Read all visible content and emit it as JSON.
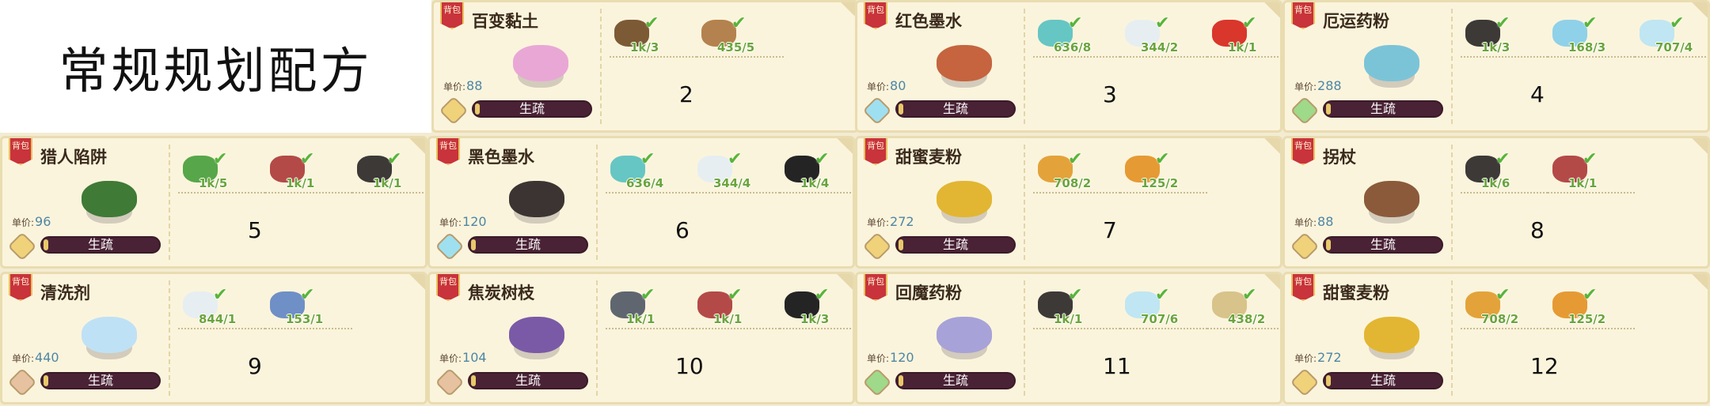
{
  "page_title": "常规规划配方",
  "labels": {
    "rarity": "背包",
    "price_prefix": "单价:",
    "proficiency": "生疏"
  },
  "colors": {
    "card_bg": "#fbf4dc",
    "count_green": "#6ba43b",
    "check_green": "#58b43a",
    "price_blue": "#4e86a5",
    "bar_dark": "#4a2235",
    "bar_fill": "#e8c96a"
  },
  "recipes": [
    {
      "number": "2",
      "name": "百变黏土",
      "price": "88",
      "badge": "gold-diamond-icon",
      "art": "pink-bear-clay",
      "ingredients": [
        {
          "name": "brown-ore-icon",
          "count": "1k/3"
        },
        {
          "name": "dirt-pile-icon",
          "count": "435/5"
        }
      ]
    },
    {
      "number": "3",
      "name": "红色墨水",
      "price": "80",
      "badge": "blue-drop-icon",
      "art": "red-ink-bottle",
      "ingredients": [
        {
          "name": "teal-pool-icon",
          "count": "636/8"
        },
        {
          "name": "white-crystal-icon",
          "count": "344/2"
        },
        {
          "name": "tomato-icon",
          "count": "1k/1"
        }
      ]
    },
    {
      "number": "4",
      "name": "厄运药粉",
      "price": "288",
      "badge": "green-leaf-icon",
      "art": "blue-powder-jar",
      "ingredients": [
        {
          "name": "dark-stone-icon",
          "count": "1k/3"
        },
        {
          "name": "blue-mushroom-icon",
          "count": "168/3"
        },
        {
          "name": "blue-crystal-icon",
          "count": "707/4"
        }
      ]
    },
    {
      "number": "5",
      "name": "猎人陷阱",
      "price": "96",
      "badge": "gold-diamond-icon",
      "art": "green-trap",
      "ingredients": [
        {
          "name": "green-grass-icon",
          "count": "1k/5"
        },
        {
          "name": "red-coral-icon",
          "count": "1k/1"
        },
        {
          "name": "dark-stone-icon",
          "count": "1k/1"
        }
      ]
    },
    {
      "number": "6",
      "name": "黑色墨水",
      "price": "120",
      "badge": "blue-drop-icon",
      "art": "black-ink-bottle",
      "ingredients": [
        {
          "name": "teal-pool-icon",
          "count": "636/4"
        },
        {
          "name": "white-crystal-icon",
          "count": "344/4"
        },
        {
          "name": "coal-icon",
          "count": "1k/4"
        }
      ]
    },
    {
      "number": "7",
      "name": "甜蜜麦粉",
      "price": "272",
      "badge": "gold-diamond-icon",
      "art": "golden-flour-pile",
      "ingredients": [
        {
          "name": "wheat-icon",
          "count": "708/2"
        },
        {
          "name": "orange-critter-icon",
          "count": "125/2"
        }
      ]
    },
    {
      "number": "8",
      "name": "拐杖",
      "price": "88",
      "badge": "gold-diamond-icon",
      "art": "wooden-cane",
      "ingredients": [
        {
          "name": "dark-stone-icon",
          "count": "1k/6"
        },
        {
          "name": "red-coral-icon",
          "count": "1k/1"
        }
      ]
    },
    {
      "number": "9",
      "name": "清洗剂",
      "price": "440",
      "badge": "brown-diamond-icon",
      "art": "blue-snowflakes",
      "ingredients": [
        {
          "name": "white-crystal-icon",
          "count": "844/1"
        },
        {
          "name": "blue-pinwheel-icon",
          "count": "153/1"
        }
      ]
    },
    {
      "number": "10",
      "name": "焦炭树枝",
      "price": "104",
      "badge": "brown-diamond-icon",
      "art": "purple-branch",
      "ingredients": [
        {
          "name": "grey-ore-icon",
          "count": "1k/1"
        },
        {
          "name": "red-coral-icon",
          "count": "1k/1"
        },
        {
          "name": "coal-icon",
          "count": "1k/3"
        }
      ]
    },
    {
      "number": "11",
      "name": "回魔药粉",
      "price": "120",
      "badge": "green-leaf-icon",
      "art": "purple-potion",
      "ingredients": [
        {
          "name": "dark-stone-icon",
          "count": "1k/1"
        },
        {
          "name": "blue-crystal-icon",
          "count": "707/6"
        },
        {
          "name": "flower-bulb-icon",
          "count": "438/2"
        }
      ]
    },
    {
      "number": "12",
      "name": "甜蜜麦粉",
      "price": "272",
      "badge": "gold-diamond-icon",
      "art": "golden-flour-pile",
      "ingredients": [
        {
          "name": "wheat-icon",
          "count": "708/2"
        },
        {
          "name": "orange-critter-icon",
          "count": "125/2"
        }
      ]
    }
  ]
}
